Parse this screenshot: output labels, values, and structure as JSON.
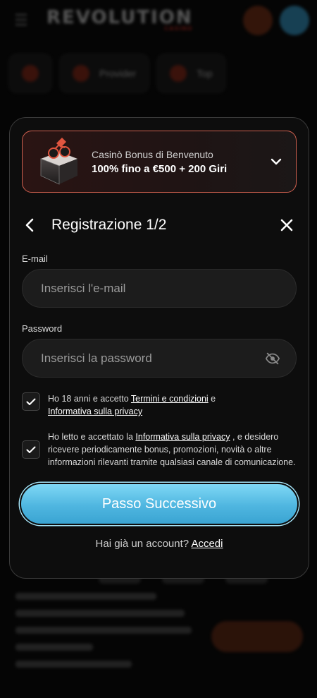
{
  "background": {
    "logo_text": "REVOLUTION",
    "logo_sub": "CASINO",
    "tabs": [
      "Provider",
      "Top"
    ]
  },
  "bonus": {
    "subtitle": "Casinò Bonus di Benvenuto",
    "title": "100% fino a €500 + 200 Giri",
    "border_color": "#d0604f"
  },
  "header": {
    "title": "Registrazione 1/2"
  },
  "form": {
    "email_label": "E-mail",
    "email_placeholder": "Inserisci l'e-mail",
    "password_label": "Password",
    "password_placeholder": "Inserisci la password"
  },
  "consents": [
    {
      "checked": true,
      "text_before": "Ho 18 anni e accetto ",
      "link1": "Termini e condizioni",
      "text_mid": " e ",
      "link2": "Informativa sulla privacy"
    },
    {
      "checked": true,
      "text_before": "Ho letto e accettato la ",
      "link1": "Informativa sulla privacy",
      "text_after": " , e desidero ricevere periodicamente bonus, promozioni, novità o altre informazioni rilevanti tramite qualsiasi canale di comunicazione."
    }
  ],
  "actions": {
    "next_label": "Passo Successivo",
    "login_prompt": "Hai già un account? ",
    "login_link": "Accedi"
  },
  "colors": {
    "accent": "#4fb6e0",
    "modal_bg": "#0d0d0d",
    "field_bg": "#1c1c1c"
  }
}
